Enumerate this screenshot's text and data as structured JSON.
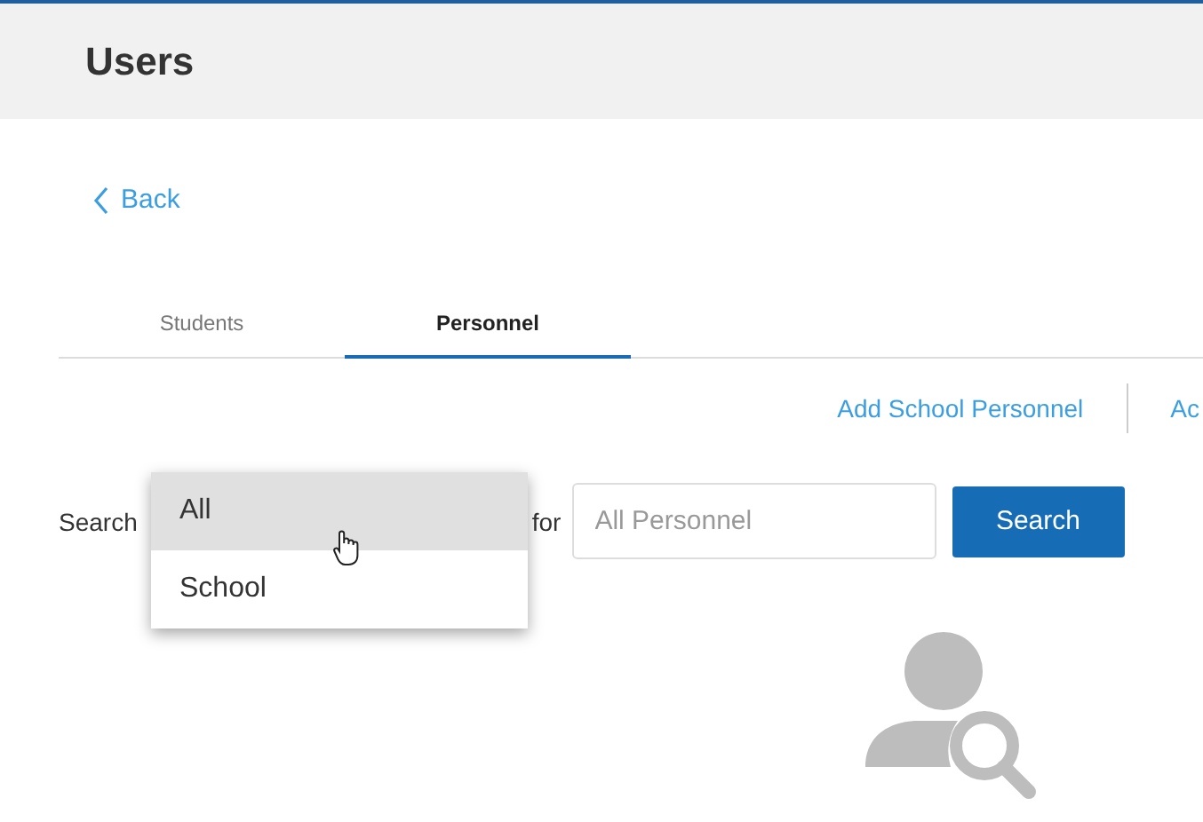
{
  "header": {
    "title": "Users"
  },
  "back_link": "Back",
  "tabs": [
    {
      "label": "Students",
      "selected": false
    },
    {
      "label": "Personnel",
      "selected": true
    }
  ],
  "actions": [
    "Add School Personnel",
    "Ac"
  ],
  "search": {
    "label": "Search",
    "for_label": "for",
    "placeholder": "All Personnel",
    "button": "Search"
  },
  "dropdown": {
    "options": [
      {
        "label": "All",
        "selected": true
      },
      {
        "label": "School",
        "selected": false
      }
    ]
  }
}
